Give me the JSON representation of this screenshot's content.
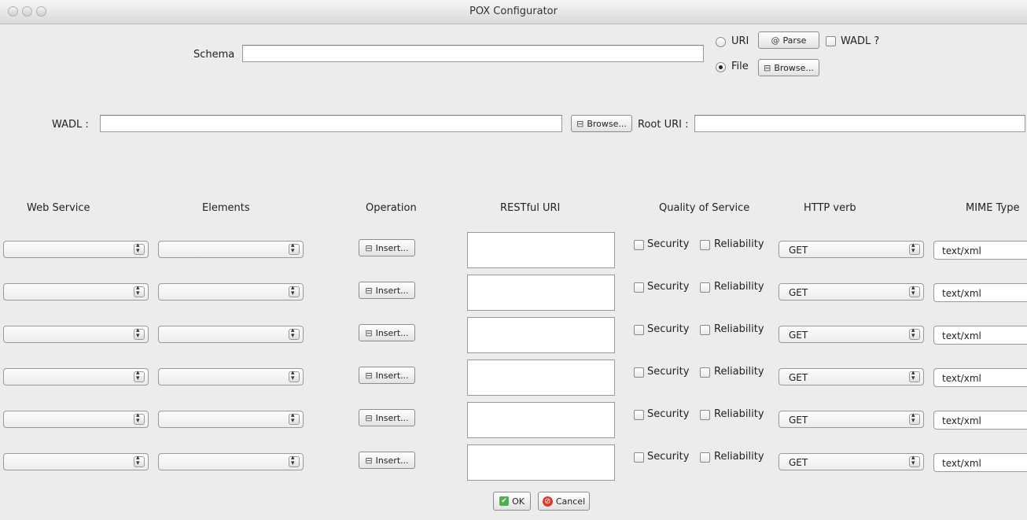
{
  "window": {
    "title": "POX Configurator"
  },
  "schema": {
    "label": "Schema",
    "value": "",
    "uri_option": "URI",
    "file_option": "File",
    "selected": "File",
    "parse_label": "Parse",
    "browse_label": "Browse...",
    "wadl_check_label": "WADL ?"
  },
  "wadl": {
    "label": "WADL :",
    "value": "",
    "browse_label": "Browse...",
    "root_uri_label": "Root URI :",
    "root_uri_value": ""
  },
  "columns": {
    "web_service": "Web Service",
    "elements": "Elements",
    "operation": "Operation",
    "restful_uri": "RESTful URI",
    "qos": "Quality of Service",
    "http_verb": "HTTP verb",
    "mime_type": "MIME Type"
  },
  "rows": [
    {
      "insert_label": "Insert...",
      "security_label": "Security",
      "reliability_label": "Reliability",
      "verb": "GET",
      "mime": "text/xml"
    },
    {
      "insert_label": "Insert...",
      "security_label": "Security",
      "reliability_label": "Reliability",
      "verb": "GET",
      "mime": "text/xml"
    },
    {
      "insert_label": "Insert...",
      "security_label": "Security",
      "reliability_label": "Reliability",
      "verb": "GET",
      "mime": "text/xml"
    },
    {
      "insert_label": "Insert...",
      "security_label": "Security",
      "reliability_label": "Reliability",
      "verb": "GET",
      "mime": "text/xml"
    },
    {
      "insert_label": "Insert...",
      "security_label": "Security",
      "reliability_label": "Reliability",
      "verb": "GET",
      "mime": "text/xml"
    },
    {
      "insert_label": "Insert...",
      "security_label": "Security",
      "reliability_label": "Reliability",
      "verb": "GET",
      "mime": "text/xml"
    }
  ],
  "footer": {
    "ok_label": "OK",
    "cancel_label": "Cancel"
  }
}
